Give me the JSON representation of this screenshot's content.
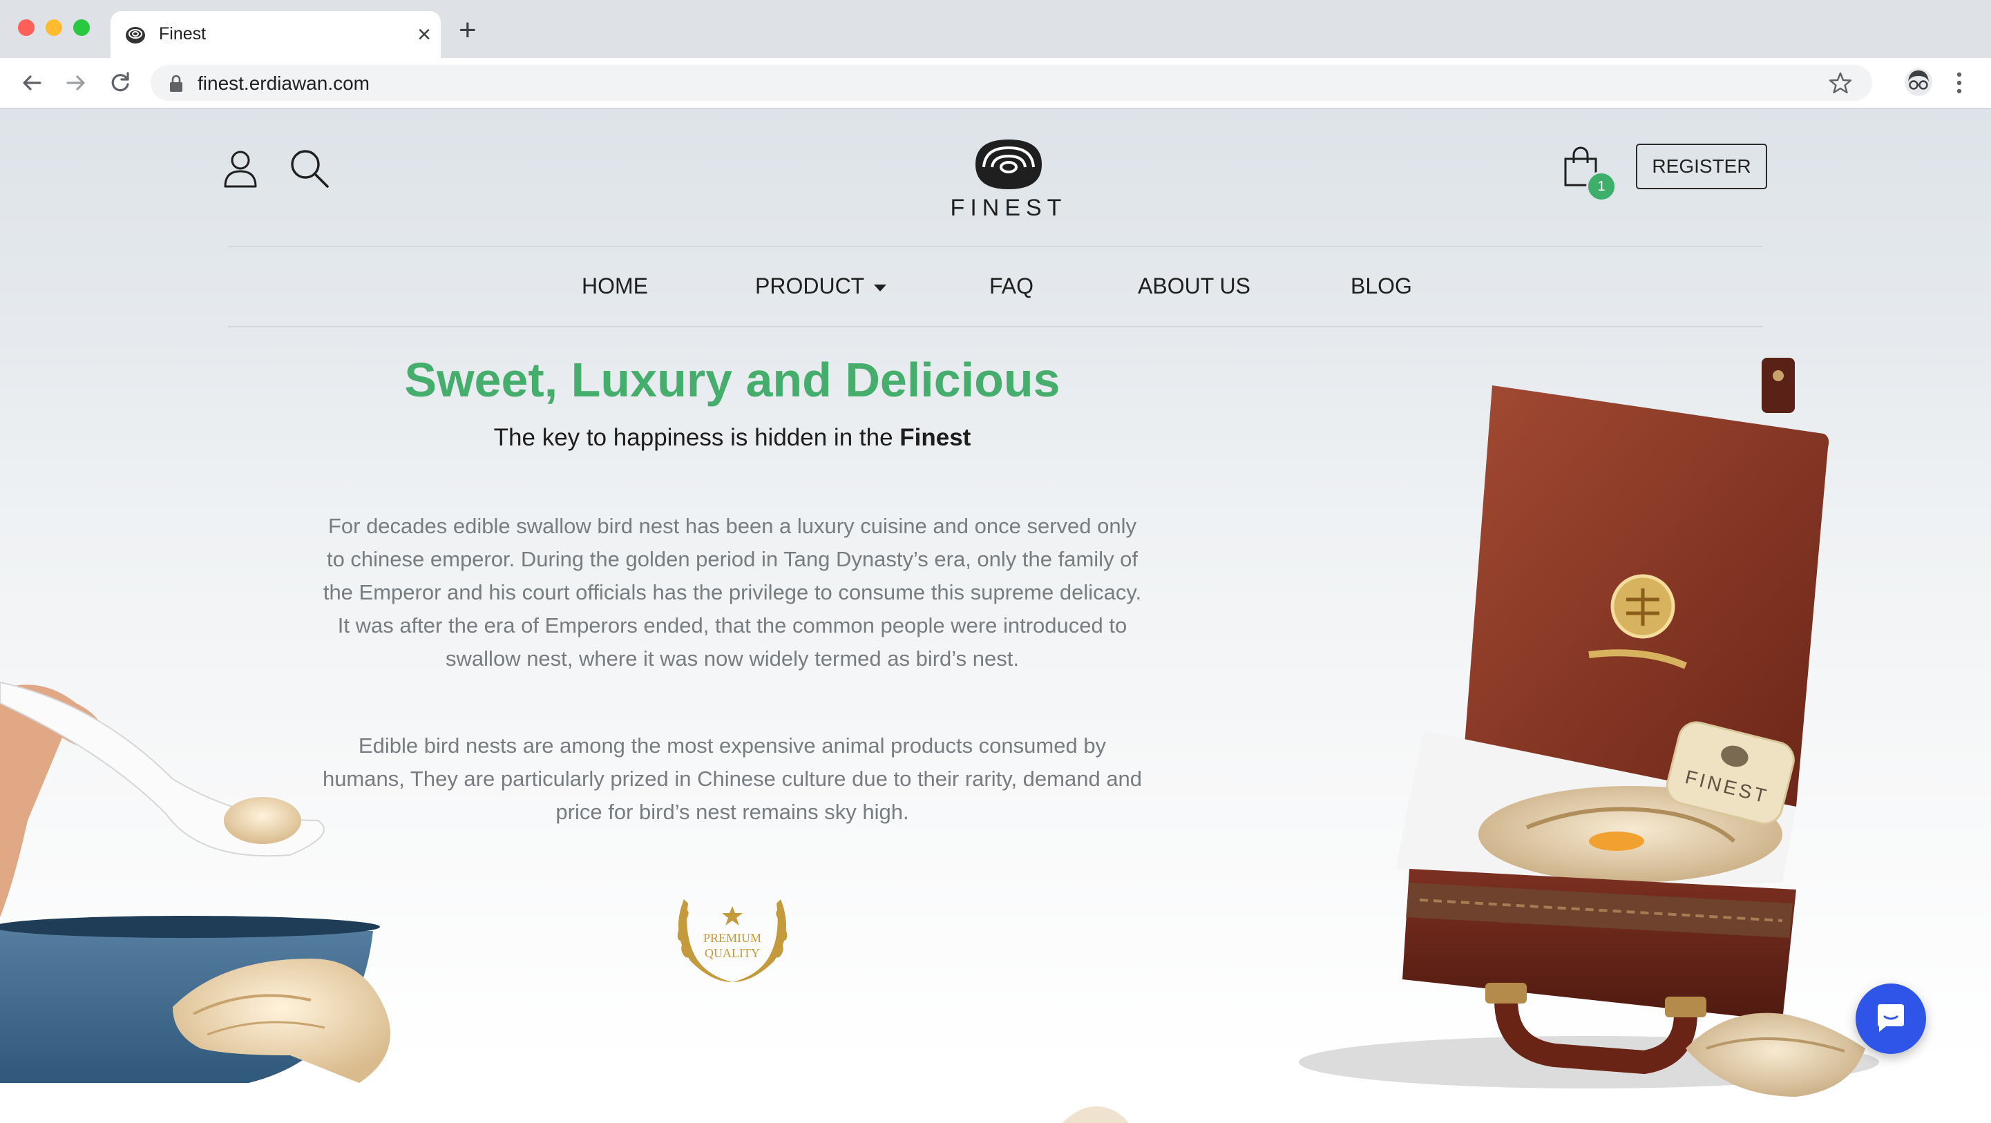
{
  "browser": {
    "tab_title": "Finest",
    "new_tab_symbol": "+",
    "close_symbol": "×",
    "url": "finest.erdiawan.com",
    "icons": [
      "back-arrow-icon",
      "forward-arrow-icon",
      "reload-icon",
      "lock-icon",
      "bookmark-star-icon",
      "profile-avatar-icon",
      "kebab-menu-icon"
    ]
  },
  "header": {
    "logo_text": "FINEST",
    "cart_count": "1",
    "register_label": "REGISTER",
    "icons": [
      "user-icon",
      "search-icon",
      "shopping-bag-icon"
    ]
  },
  "nav": {
    "items": [
      {
        "label": "HOME"
      },
      {
        "label": "PRODUCT"
      },
      {
        "label": "FAQ"
      },
      {
        "label": "ABOUT US"
      },
      {
        "label": "BLOG"
      }
    ]
  },
  "hero": {
    "title": "Sweet, Luxury and Delicious",
    "subtitle_prefix": "The key to happiness is hidden in the ",
    "subtitle_bold": "Finest",
    "paragraph_1": "For decades edible swallow bird nest has been a luxury cuisine and once served only to chinese emperor. During the golden period in Tang Dynasty’s era, only the family of the Emperor and his court officials has the privilege to consume this supreme delicacy. It was after the era of Emperors ended, that the common people were introduced to swallow nest, where it was now widely termed as bird’s nest.",
    "paragraph_2": "Edible bird nests are among the most expensive animal products consumed by humans, They are particularly prized in Chinese culture due to their rarity, demand and price for bird’s nest remains sky high.",
    "badge_line_1": "PREMIUM",
    "badge_line_2": "QUALITY",
    "box_label": "FINEST"
  },
  "colors": {
    "accent_green": "#45ae6c",
    "badge_gold": "#c59a3c",
    "chat_blue": "#2f55e8",
    "box_leather": "#8a3a26"
  }
}
